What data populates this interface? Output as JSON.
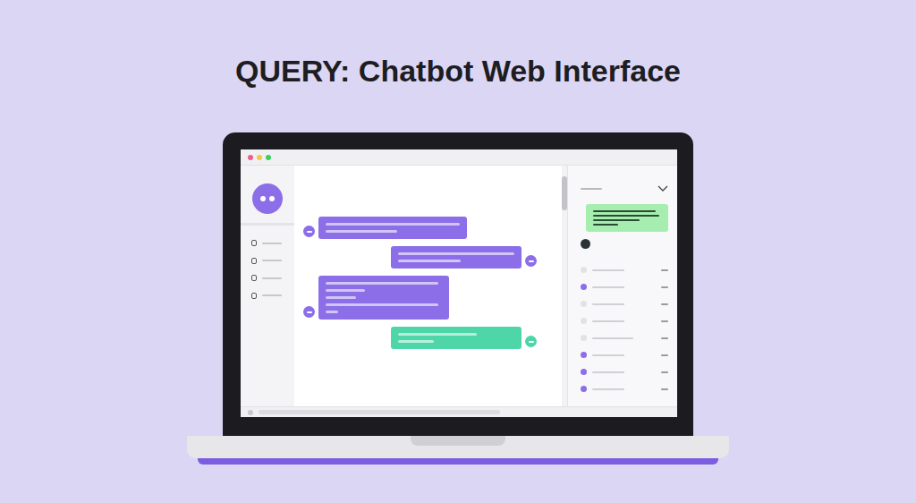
{
  "title": "QUERY: Chatbot Web Interface",
  "window": {
    "controls": [
      {
        "color": "#f45b8a"
      },
      {
        "color": "#f5c842"
      },
      {
        "color": "#3ccf5a"
      }
    ]
  },
  "sidebar": {
    "items": [
      {
        "selected": false
      },
      {
        "selected": false
      },
      {
        "selected": false
      },
      {
        "selected": false
      }
    ]
  },
  "messages": [
    {
      "kind": "bot",
      "color": "#8b6ee8"
    },
    {
      "kind": "user",
      "color": "#8b6ee8"
    },
    {
      "kind": "bot",
      "color": "#8b6ee8"
    },
    {
      "kind": "user",
      "color": "#4fd6a8"
    }
  ],
  "panel": {
    "rows": [
      {
        "active": false
      },
      {
        "active": true
      },
      {
        "active": false
      },
      {
        "active": false
      },
      {
        "active": false
      },
      {
        "active": true
      },
      {
        "active": true
      },
      {
        "active": true
      }
    ]
  }
}
